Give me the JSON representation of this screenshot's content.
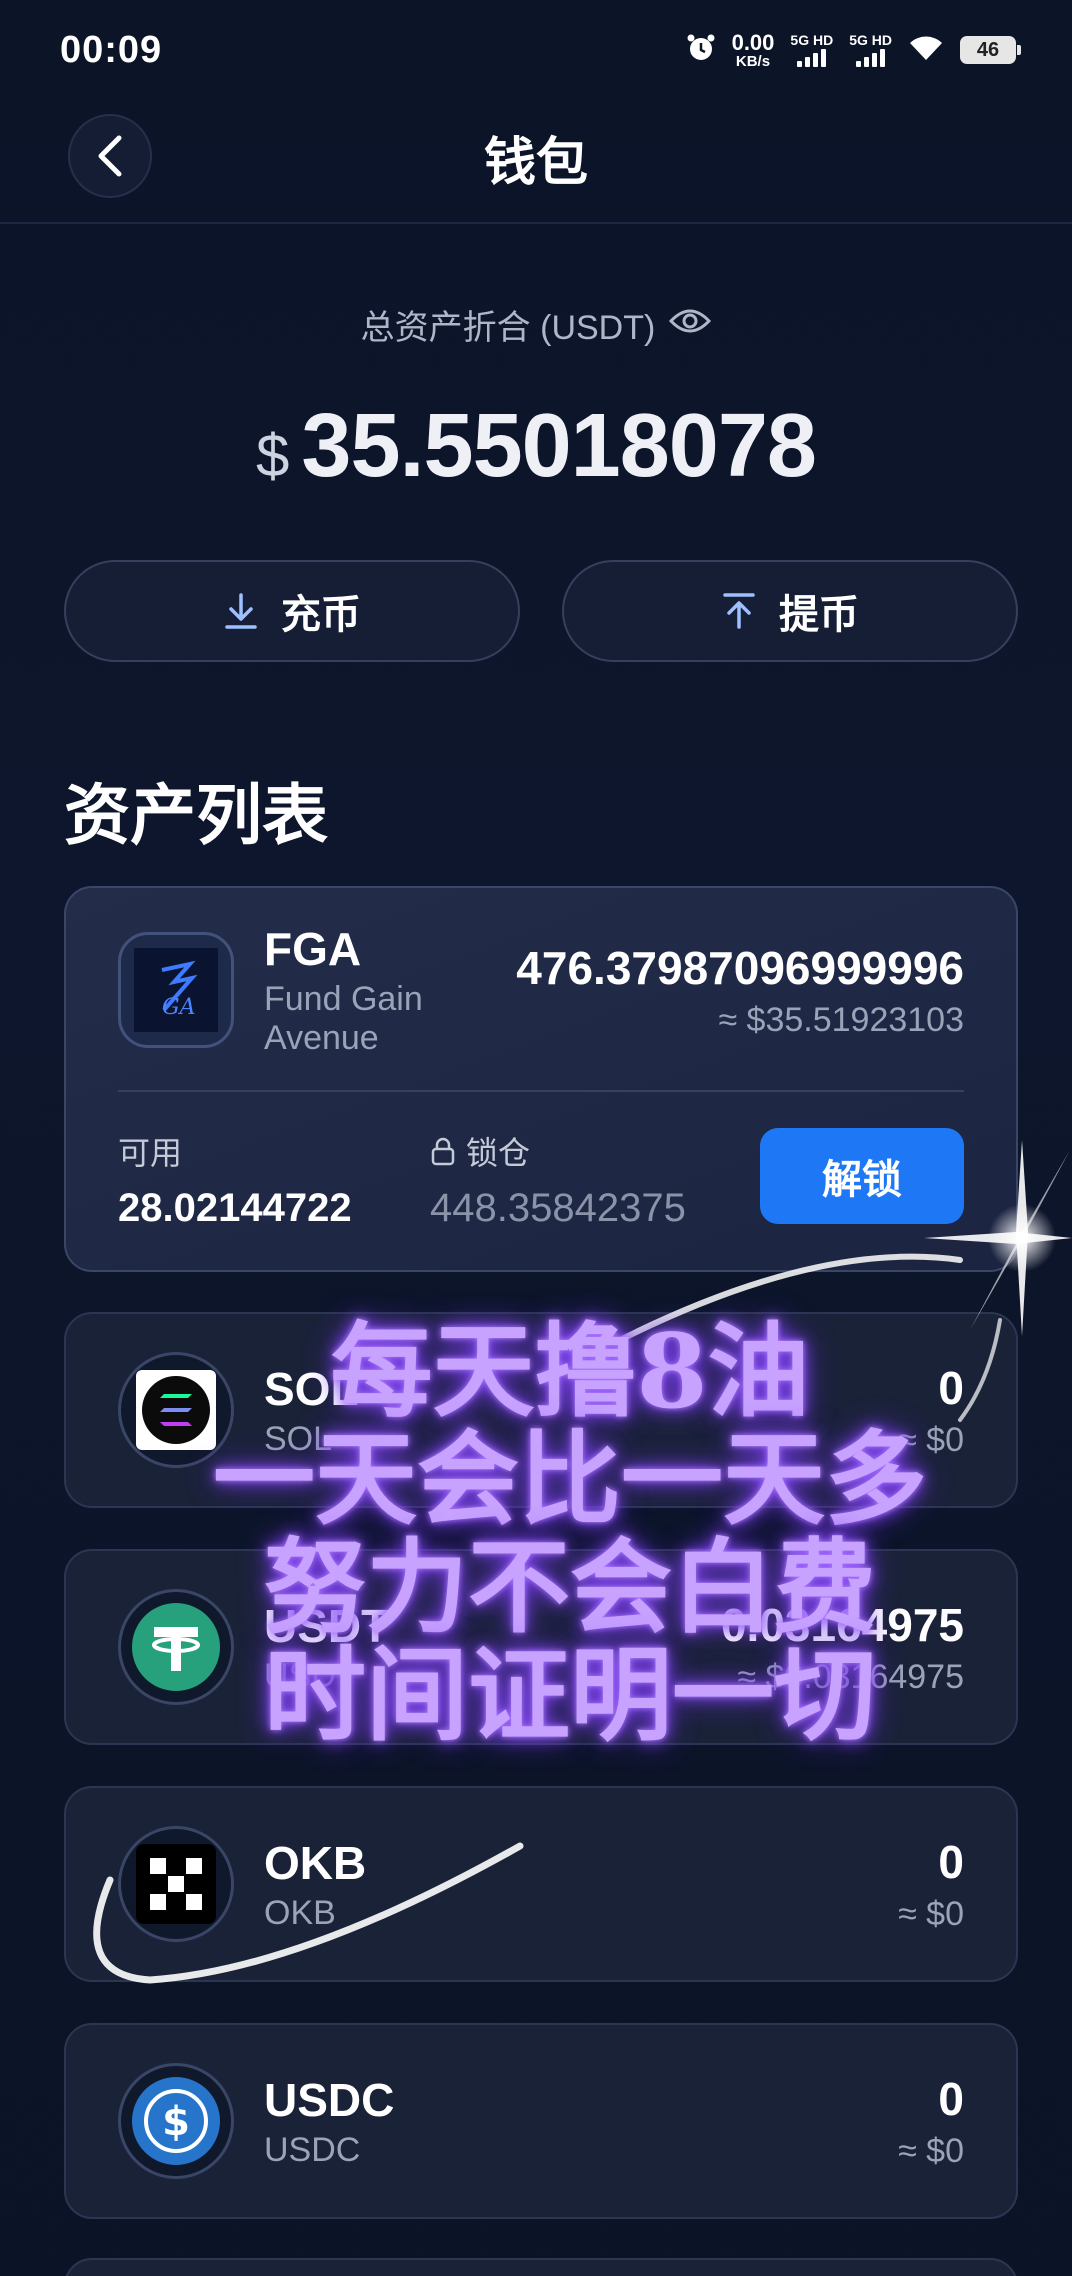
{
  "status_bar": {
    "time": "00:09",
    "net_speed": "0.00",
    "net_unit": "KB/s",
    "sim1": "5G HD",
    "sim2": "5G HD",
    "battery": "46"
  },
  "header": {
    "title": "钱包"
  },
  "summary": {
    "label": "总资产折合 (USDT)",
    "currency_symbol": "$",
    "total": "35.55018078"
  },
  "actions": {
    "deposit": "充币",
    "withdraw": "提币"
  },
  "asset_list": {
    "title": "资产列表",
    "featured": {
      "symbol": "FGA",
      "name": "Fund Gain Avenue",
      "amount": "476.37987096999996",
      "usd": "≈ $35.51923103",
      "available_label": "可用",
      "available": "28.02144722",
      "locked_label": "锁仓",
      "locked": "448.35842375",
      "unlock_label": "解锁"
    },
    "items": [
      {
        "symbol": "SOL",
        "name": "SOL",
        "amount": "0",
        "usd": "≈ $0"
      },
      {
        "symbol": "USDT",
        "name": "USDT",
        "amount": "0.03164975",
        "usd": "≈ $0.03164975"
      },
      {
        "symbol": "OKB",
        "name": "OKB",
        "amount": "0",
        "usd": "≈ $0"
      },
      {
        "symbol": "USDC",
        "name": "USDC",
        "amount": "0",
        "usd": "≈ $0"
      }
    ]
  },
  "overlay_text": [
    "每天撸8油",
    "一天会比一天多",
    "努力不会白费",
    "时间证明一切"
  ],
  "colors": {
    "accent": "#1e78f5",
    "background": "#0c1428",
    "overlay": "#c7a2ff"
  }
}
